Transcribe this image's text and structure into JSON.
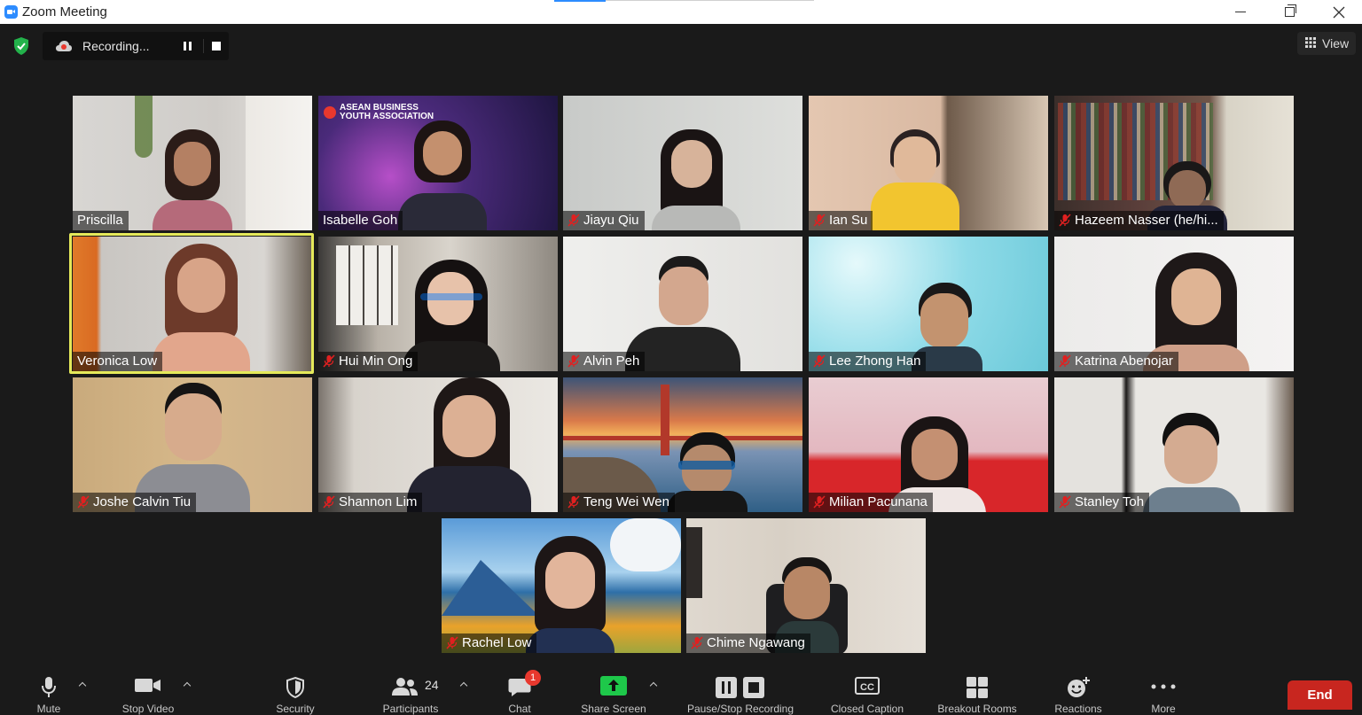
{
  "window": {
    "title": "Zoom Meeting"
  },
  "recording": {
    "status_text": "Recording..."
  },
  "view_button": {
    "label": "View"
  },
  "participants": [
    {
      "name": "Priscilla",
      "muted": false
    },
    {
      "name": "Isabelle Goh",
      "muted": false,
      "bg_text": "ASEAN BUSINESS YOUTH ASSOCIATION"
    },
    {
      "name": "Jiayu Qiu",
      "muted": true
    },
    {
      "name": "Ian Su",
      "muted": true
    },
    {
      "name": "Hazeem Nasser (he/hi...",
      "muted": true
    },
    {
      "name": "Veronica Low",
      "muted": false,
      "active_speaker": true
    },
    {
      "name": "Hui Min Ong",
      "muted": true
    },
    {
      "name": "Alvin Peh",
      "muted": true
    },
    {
      "name": "Lee Zhong Han",
      "muted": true
    },
    {
      "name": "Katrina Abenojar",
      "muted": true
    },
    {
      "name": "Joshe Calvin Tiu",
      "muted": true
    },
    {
      "name": "Shannon Lim",
      "muted": true
    },
    {
      "name": "Teng Wei Wen",
      "muted": true
    },
    {
      "name": "Milian Pacunana",
      "muted": true
    },
    {
      "name": "Stanley Toh",
      "muted": true
    },
    {
      "name": "Rachel Low",
      "muted": true
    },
    {
      "name": "Chime Ngawang",
      "muted": true
    }
  ],
  "toolbar": {
    "mute_label": "Mute",
    "video_label": "Stop Video",
    "security_label": "Security",
    "participants_label": "Participants",
    "participants_count": "24",
    "chat_label": "Chat",
    "chat_badge": "1",
    "share_label": "Share Screen",
    "record_label": "Pause/Stop Recording",
    "captions_label": "Closed Caption",
    "captions_icon_text": "CC",
    "breakout_label": "Breakout Rooms",
    "reactions_label": "Reactions",
    "more_label": "More",
    "end_label": "End"
  },
  "colors": {
    "background": "#1a1a1a",
    "active_speaker": "#e5e95a",
    "end_button": "#c8261f",
    "share_button": "#1ec84a",
    "mute_icon": "#e02020"
  }
}
